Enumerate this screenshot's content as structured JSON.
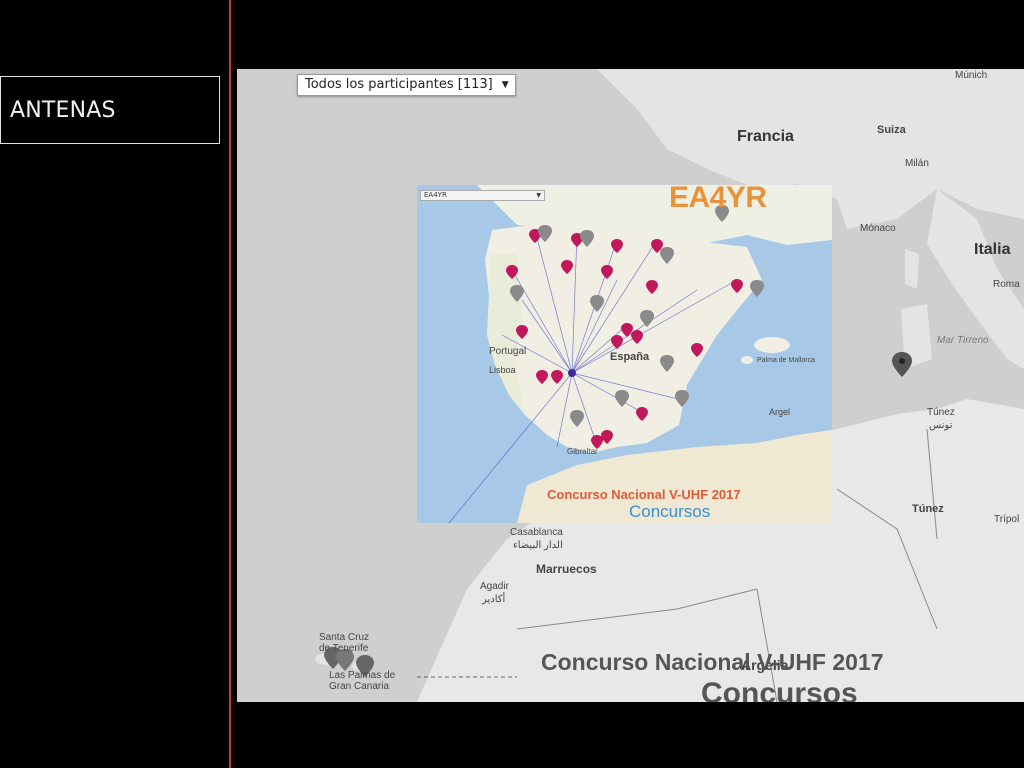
{
  "sidebar": {
    "title": "ANTENAS"
  },
  "map": {
    "participants_select": "Todos los participantes [113]",
    "labels": {
      "francia": "Francia",
      "italia": "Italia",
      "munich": "Múnich",
      "suiza": "Suiza",
      "milan": "Milán",
      "monaco": "Mónaco",
      "roma": "Roma",
      "mar_tirreno": "Mar Tirreno",
      "tunez_city": "Túnez",
      "tunez_city_ar": "تونس",
      "tunez_country": "Túnez",
      "tripoli": "Trípol",
      "casablanca": "Casablanca",
      "casablanca_ar": "الدار البيضاء",
      "marruecos": "Marruecos",
      "agadir": "Agadir",
      "agadir_ar": "أكادير",
      "santa_cruz": "Santa Cruz de Tenerife",
      "las_palmas": "Las Palmas de Gran Canaria",
      "argelia": "Argelia"
    },
    "inset": {
      "station_select": "EA4YR",
      "callsign": "EA4YR",
      "labels": {
        "espana": "España",
        "portugal": "Portugal",
        "lisboa": "Lisboa",
        "gibraltar": "Gibraltar",
        "argel": "Argel",
        "palma": "Palma de Mallorca"
      },
      "contest_title": "Concurso Nacional V-UHF 2017",
      "brand": "Concursos"
    },
    "contest_title": "Concurso Nacional V-UHF 2017",
    "brand": "Concursos"
  },
  "colors": {
    "divider": "#c0392b",
    "callsign": "#e8923c",
    "brand": "#3c8ed0",
    "pin_pink": "#c2185b",
    "sea": "#a8c8e8"
  }
}
